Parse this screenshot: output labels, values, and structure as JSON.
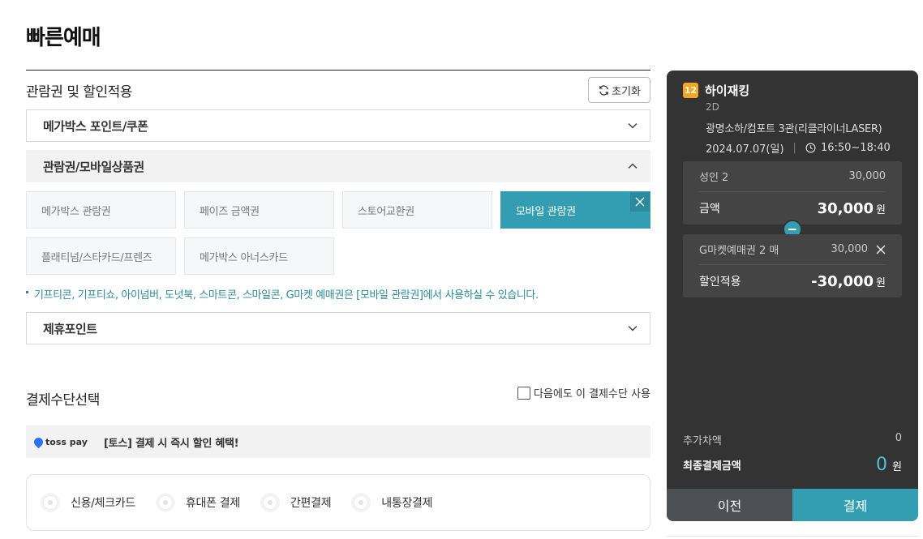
{
  "page": {
    "title": "빠른예매"
  },
  "discount": {
    "title": "관람권 및 할인적용",
    "reset_label": "초기화",
    "accordion": [
      {
        "label": "메가박스 포인트/쿠폰"
      },
      {
        "label": "관람권/모바일상품권"
      }
    ],
    "tickets": [
      {
        "label": "메가박스 관람권"
      },
      {
        "label": "페이즈 금액권"
      },
      {
        "label": "스토어교환권"
      },
      {
        "label": "모바일 관람권"
      },
      {
        "label": "플래티넘/스타카드/프렌즈"
      },
      {
        "label": "메가박스 아너스카드"
      }
    ],
    "notice": "기프티콘, 기프티쇼, 아이넘버, 도넛북, 스마트콘, 스마일콘, G마켓 예매권은 [모바일 관람권]에서 사용하실 수 있습니다.",
    "partner_label": "제휴포인트"
  },
  "payment": {
    "title": "결제수단선택",
    "remember_label": "다음에도 이 결제수단 사용",
    "toss_logo": "toss pay",
    "toss_text": "[토스] 결제 시 즉시 할인 혜택!",
    "methods": [
      {
        "label": "신용/체크카드"
      },
      {
        "label": "휴대폰 결제"
      },
      {
        "label": "간편결제"
      },
      {
        "label": "내통장결제"
      }
    ]
  },
  "summary": {
    "age_rating": "12",
    "movie_title": "하이재킹",
    "format": "2D",
    "theater": "광명소하/컴포트 3관(리클라이너LASER)",
    "date": "2024.07.07(일)",
    "time": "16:50~18:40",
    "adult_label": "성인 2",
    "adult_price": "30,000",
    "amount_label": "금액",
    "amount_value": "30,000",
    "won": "원",
    "coupon_label": "G마켓예매권 2 매",
    "coupon_price": "30,000",
    "discount_label": "할인적용",
    "discount_value": "-30,000",
    "extra_label": "추가차액",
    "extra_value": "0",
    "final_label": "최종결제금액",
    "final_value": "0",
    "prev_label": "이전",
    "pay_label": "결제"
  },
  "colors": {
    "accent": "#339eb2",
    "panel": "#333333"
  }
}
